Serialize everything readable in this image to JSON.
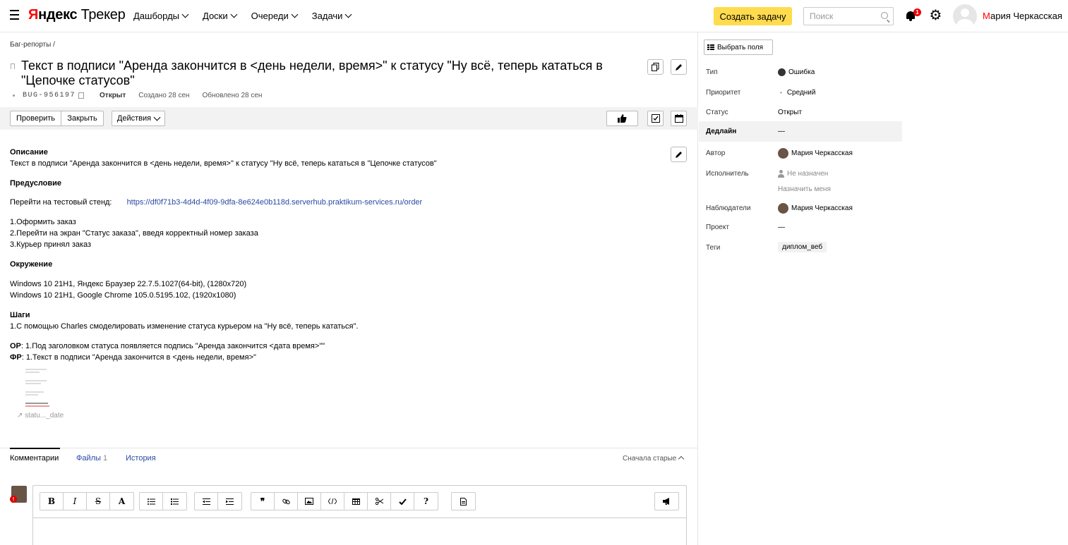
{
  "header": {
    "logo_brand_1": "Я",
    "logo_brand_2": "ндекс",
    "logo_product": "Трекер",
    "nav": [
      "Дашборды",
      "Доски",
      "Очереди",
      "Задачи"
    ],
    "create_label": "Создать задачу",
    "search_placeholder": "Поиск",
    "notifications_count": "1",
    "user_name_first_letter": "М",
    "user_name_rest": "ария Черкасская"
  },
  "issue": {
    "breadcrumb": "Баг-репорты /",
    "title": "Текст в подписи \"Аренда закончится в <день недели, время>\" к статусу \"Ну всё, теперь кататься в \"Цепочке статусов\"",
    "key": "BUG-956197",
    "status": "Открыт",
    "created": "Создано 28 сен",
    "updated": "Обновлено 28 сен"
  },
  "toolbar": {
    "check_label": "Проверить",
    "close_label": "Закрыть",
    "actions_label": "Действия"
  },
  "description": {
    "h_desc": "Описание",
    "desc_text": "Текст в подписи \"Аренда закончится в <день недели, время>\" к статусу \"Ну всё, теперь кататься в \"Цепочке статусов\"",
    "h_pre": "Предусловие",
    "pre_label": "Перейти на тестовый стенд:",
    "pre_link": "https://df0f71b3-4d4d-4f09-9dfa-8e624e0b118d.serverhub.praktikum-services.ru/order",
    "steps_pre": [
      "1.Оформить заказ",
      "2.Перейти на экран \"Статус заказа\", введя корректный номер заказа",
      "3.Курьер принял заказ"
    ],
    "h_env": "Окружение",
    "env": [
      "Windows 10 21H1, Яндекс Браузер 22.7.5.1027(64-bit), (1280x720)",
      "Windows 10 21H1, Google Chrome 105.0.5195.102, (1920x1080)"
    ],
    "h_steps": "Шаги",
    "step1": "1.С помощью Charles смоделировать изменение статуса курьером на \"Ну всё, теперь кататься\".",
    "or_label": "ОР",
    "or_text": ": 1.Под заголовком статуса появляется подпись \"Аренда закончится <дата время>\"\"",
    "fr_label": "ФР",
    "fr_text": ": 1.Текст в подписи \"Аренда закончится в <день недели, время>\"",
    "attachment_caption": "statu..._date"
  },
  "tabs": {
    "comments": "Комментарии",
    "files": "Файлы",
    "files_count": "1",
    "history": "История",
    "sort": "Сначала старые"
  },
  "editor": {
    "bold": "B",
    "italic": "I",
    "strike": "S",
    "font": "A",
    "quote": "❞",
    "help": "?",
    "comment_badge": "!"
  },
  "sidebar": {
    "fields_label": "Выбрать поля",
    "type_label": "Тип",
    "type_value": "Ошибка",
    "priority_label": "Приоритет",
    "priority_value": "Средний",
    "status_label": "Статус",
    "status_value": "Открыт",
    "deadline_label": "Дедлайн",
    "deadline_value": "—",
    "author_label": "Автор",
    "author_value": "Мария Черкасская",
    "assignee_label": "Исполнитель",
    "assignee_value": "Не назначен",
    "assign_me": "Назначить меня",
    "watchers_label": "Наблюдатели",
    "watchers_value": "Мария Черкасская",
    "project_label": "Проект",
    "project_value": "—",
    "tags_label": "Теги",
    "tags_value": "диплом_веб"
  }
}
